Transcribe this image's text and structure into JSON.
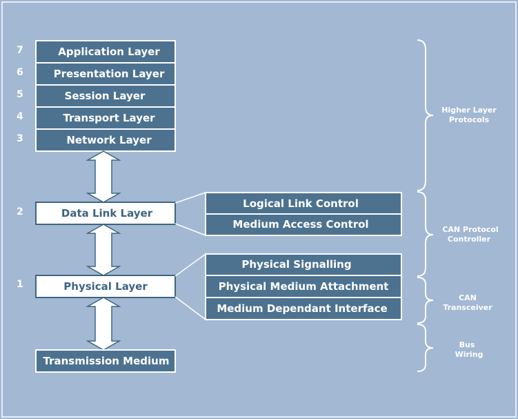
{
  "colors": {
    "background": "#a3b8d3",
    "box": "#4d7290",
    "box_text": "#ffffff",
    "highlight_box": "#ffffff",
    "highlight_text": "#3d6582"
  },
  "upper_layers": [
    {
      "number": "7",
      "label": "Application Layer"
    },
    {
      "number": "6",
      "label": "Presentation Layer"
    },
    {
      "number": "5",
      "label": "Session Layer"
    },
    {
      "number": "4",
      "label": "Transport Layer"
    },
    {
      "number": "3",
      "label": "Network Layer"
    }
  ],
  "data_link": {
    "number": "2",
    "label": "Data Link Layer",
    "sublayers": [
      "Logical Link Control",
      "Medium Access Control"
    ]
  },
  "physical": {
    "number": "1",
    "label": "Physical Layer",
    "sublayers": [
      "Physical Signalling",
      "Physical Medium Attachment",
      "Medium Dependant Interface"
    ]
  },
  "medium": {
    "label": "Transmission Medium"
  },
  "groups": [
    {
      "lines": [
        "Higher Layer",
        "Protocols"
      ]
    },
    {
      "lines": [
        "CAN Protocol",
        "Controller"
      ]
    },
    {
      "lines": [
        "CAN",
        "Transceiver"
      ]
    },
    {
      "lines": [
        "Bus",
        "Wiring"
      ]
    }
  ]
}
